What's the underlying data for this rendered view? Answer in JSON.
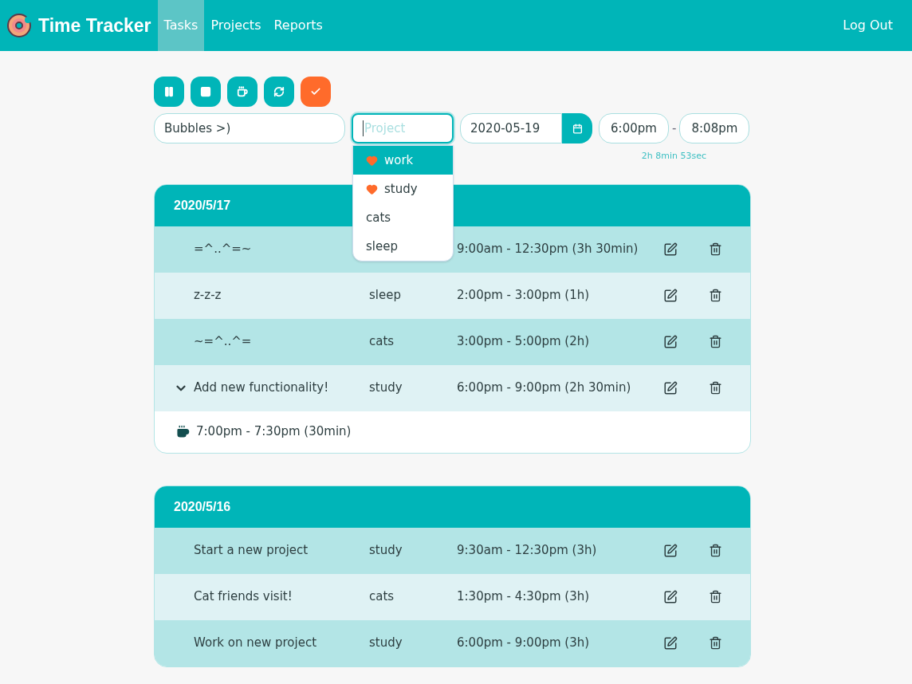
{
  "app": {
    "title": "Time Tracker"
  },
  "nav": [
    {
      "label": "Tasks",
      "selected": true
    },
    {
      "label": "Projects",
      "selected": false
    },
    {
      "label": "Reports",
      "selected": false
    }
  ],
  "logout": "Log Out",
  "form": {
    "description": "Bubbles >)",
    "project_placeholder": "Project",
    "date": "2020-05-19",
    "start": "6:00pm",
    "separator": "-",
    "end": "8:08pm",
    "elapsed": "2h 8min 53sec"
  },
  "project_options": [
    {
      "label": "work",
      "favorite": true,
      "selected": true
    },
    {
      "label": "study",
      "favorite": true,
      "selected": false
    },
    {
      "label": "cats",
      "favorite": false,
      "selected": false
    },
    {
      "label": "sleep",
      "favorite": false,
      "selected": false
    }
  ],
  "days": [
    {
      "date": "2020/5/17",
      "entries": [
        {
          "task": "=^..^=~",
          "time": "9:00am - 12:30pm (3h 30min)",
          "expanded": false
        },
        {
          "task": "z-z-z",
          "project": "sleep",
          "time": "2:00pm - 3:00pm (1h)",
          "expanded": false
        },
        {
          "task": "~=^..^=",
          "project": "cats",
          "time": "3:00pm - 5:00pm (2h)",
          "expanded": false
        },
        {
          "task": "Add new functionality!",
          "project": "study",
          "time": "6:00pm - 9:00pm (2h 30min)",
          "expanded": true,
          "breaks": [
            "7:00pm - 7:30pm (30min)"
          ]
        }
      ]
    },
    {
      "date": "2020/5/16",
      "entries": [
        {
          "task": "Start a new project",
          "project": "study",
          "time": "9:30am - 12:30pm (3h)",
          "expanded": false
        },
        {
          "task": "Cat friends visit!",
          "project": "cats",
          "time": "1:30pm - 4:30pm (3h)",
          "expanded": false
        },
        {
          "task": "Work on new project",
          "project": "study",
          "time": "6:00pm - 9:00pm (3h)",
          "expanded": false
        }
      ]
    }
  ]
}
